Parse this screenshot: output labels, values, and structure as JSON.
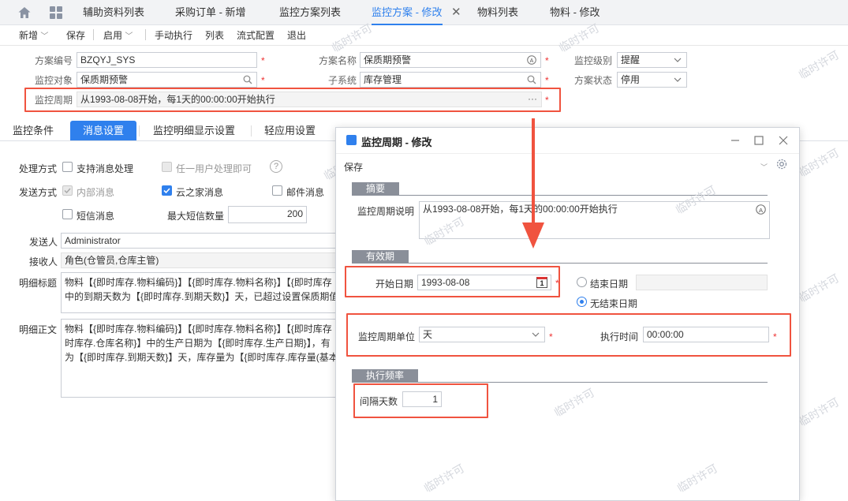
{
  "tabs": [
    {
      "label": "辅助资料列表"
    },
    {
      "label": "采购订单 - 新增"
    },
    {
      "label": "监控方案列表"
    },
    {
      "label": "监控方案 - 修改",
      "active": true
    },
    {
      "label": "物料列表"
    },
    {
      "label": "物料 - 修改"
    }
  ],
  "toolbar": {
    "new": "新增",
    "save": "保存",
    "enable": "启用",
    "manual": "手动执行",
    "list": "列表",
    "flow": "流式配置",
    "exit": "退出"
  },
  "form": {
    "code_label": "方案编号",
    "code": "BZQYJ_SYS",
    "name_label": "方案名称",
    "name": "保质期预警",
    "level_label": "监控级别",
    "level": "提醒",
    "object_label": "监控对象",
    "object": "保质期预警",
    "subsys_label": "子系统",
    "subsys": "库存管理",
    "status_label": "方案状态",
    "status": "停用",
    "period_label": "监控周期",
    "period": "从1993-08-08开始，每1天的00:00:00开始执行",
    "required": "*"
  },
  "section_tabs": [
    "监控条件",
    "消息设置",
    "监控明细显示设置",
    "轻应用设置"
  ],
  "msg": {
    "handle_label": "处理方式",
    "support_handle": "支持消息处理",
    "any_user": "任一用户处理即可",
    "help": "?",
    "send_label": "发送方式",
    "internal": "内部消息",
    "yunzhijia": "云之家消息",
    "email": "邮件消息",
    "sms": "短信消息",
    "max_sms_label": "最大短信数量",
    "max_sms": "200",
    "sender_label": "发送人",
    "sender": "Administrator",
    "receiver_label": "接收人",
    "receiver": "角色(仓管员,仓库主管)",
    "title_label": "明细标题",
    "title_line1": "物料【{即时库存.物料编码}】【{即时库存.物料名称}】【{即时库存",
    "title_line2": "中的到期天数为【{即时库存.到期天数}】天，已超过设置保质期值",
    "body_label": "明细正文",
    "body_line1": "物料【{即时库存.物料编码}】【{即时库存.物料名称}】【{即时库存",
    "body_line2": "时库存.仓库名称}】中的生产日期为【{即时库存.生产日期}】，有",
    "body_line3": "为【{即时库存.到期天数}】天，库存量为【{即时库存.库存量(基本"
  },
  "dialog": {
    "title": "监控周期 - 修改",
    "save": "保存",
    "summary_header": "摘要",
    "desc_label": "监控周期说明",
    "desc": "从1993-08-08开始，每1天的00:00:00开始执行",
    "valid_header": "有效期",
    "start_label": "开始日期",
    "start": "1993-08-08",
    "calendar_day": "1",
    "end_label": "结束日期",
    "no_end_label": "无结束日期",
    "unit_label": "监控周期单位",
    "unit": "天",
    "time_label": "执行时间",
    "time": "00:00:00",
    "freq_header": "执行频率",
    "interval_label": "间隔天数",
    "interval": "1",
    "required": "*"
  },
  "watermark": "临时许可",
  "colors": {
    "accent": "#2f80ed",
    "highlight": "#f0533f",
    "required": "#ee3333"
  }
}
